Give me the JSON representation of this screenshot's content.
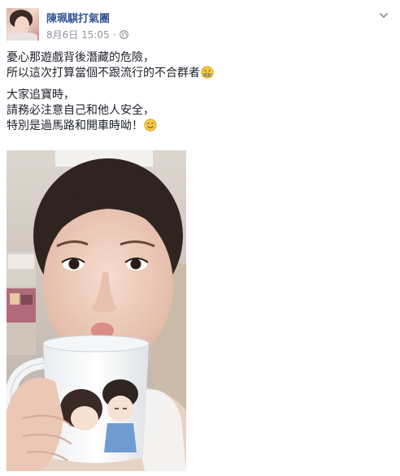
{
  "post": {
    "author": "陳珮騏打氣團",
    "date": "8月6日",
    "time": "15:05",
    "separator": "·",
    "privacy_icon": "globe-icon",
    "menu_icon": "chevron-down-icon",
    "message": {
      "paragraph1": {
        "line1": "憂心那遊戲背後潛藏的危險，",
        "line2": "所以這次打算當個不跟流行的不合群者"
      },
      "paragraph2": {
        "line1": "大家追寶時，",
        "line2": "請務必注意自己和他人安全，",
        "line3": "特別是過馬路和開車時呦！"
      }
    },
    "emojis": [
      "grimace-emoji-icon",
      "smile-emoji-icon"
    ],
    "photo_icon": "selfie-with-mug-photo"
  },
  "colors": {
    "author_link": "#365899",
    "meta_text": "#90949c",
    "body_text": "#1d2129",
    "emoji_yellow": "#f7c948"
  }
}
